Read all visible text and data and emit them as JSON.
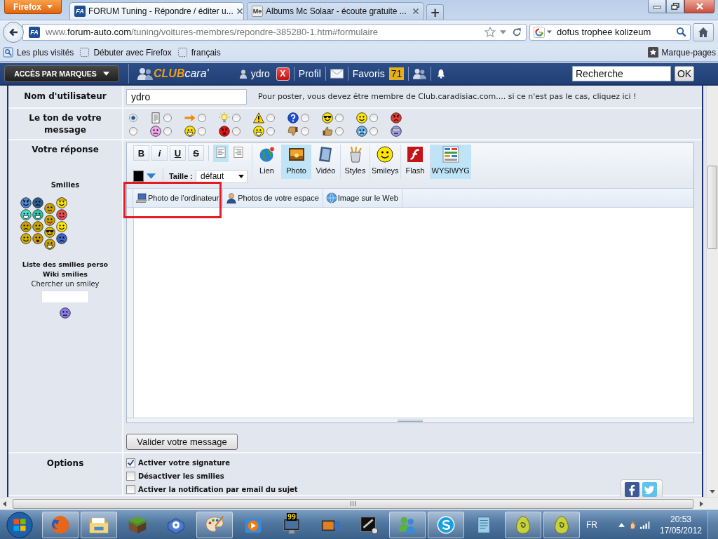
{
  "browser": {
    "menu_button": "Firefox",
    "tabs": [
      {
        "favicon": "FA",
        "title": "FORUM Tuning - Répondre / éditer u...",
        "selected": true
      },
      {
        "favicon": "Me",
        "title": "Albums Mc Solaar - écoute gratuite ...",
        "selected": false
      }
    ],
    "new_tab": "+",
    "address": {
      "favicon": "FA",
      "prefix": "www.",
      "domain": "forum-auto.com",
      "path": "/tuning/voitures-membres/repondre-385280-1.htm#formulaire"
    },
    "search": {
      "value": "dofus trophee kolizeum"
    },
    "bookmarks": [
      {
        "kind": "most-visited",
        "label": "Les plus visités"
      },
      {
        "kind": "page",
        "label": "Débuter avec Firefox"
      },
      {
        "kind": "page",
        "label": "français"
      }
    ],
    "bookmarks_menu": "Marque-pages"
  },
  "site_header": {
    "brands_button": "ACCÈS PAR MARQUES",
    "logo": {
      "club": "CLUB",
      "cara": "cara'"
    },
    "user": "ydro",
    "logout": "X",
    "profile": "Profil",
    "favorites": "Favoris",
    "favorites_count": "71",
    "search": {
      "value": "Recherche"
    },
    "search_button": "OK"
  },
  "form": {
    "username": {
      "label": "Nom d'utilisateur",
      "value": "ydro",
      "notice": "Pour poster, vous devez être membre de Club.caradisiac.com.... si ce n'est pas le cas, cliquez ici !"
    },
    "tone": {
      "label": "Le ton de votre message",
      "options": [
        {
          "kind": "document",
          "selected": true
        },
        {
          "kind": "arrow",
          "selected": false
        },
        {
          "kind": "bulb",
          "selected": false
        },
        {
          "kind": "warning",
          "selected": false
        },
        {
          "kind": "question",
          "selected": false
        },
        {
          "kind": "cool",
          "selected": false
        },
        {
          "kind": "smile",
          "selected": false
        },
        {
          "kind": "angry",
          "selected": false
        },
        {
          "kind": "sad",
          "selected": false
        },
        {
          "kind": "grin",
          "selected": false
        },
        {
          "kind": "mad",
          "selected": false
        },
        {
          "kind": "happy",
          "selected": false
        },
        {
          "kind": "thumbs-down",
          "selected": false
        },
        {
          "kind": "thumbs-up",
          "selected": false
        },
        {
          "kind": "cry",
          "selected": false
        },
        {
          "kind": "shades",
          "selected": false
        }
      ]
    },
    "reply": {
      "label": "Votre réponse",
      "smilies": {
        "title": "Smilies",
        "links": [
          "Liste des smilies perso",
          "Wiki smilies"
        ],
        "search_label": "Chercher un smiley"
      },
      "editor": {
        "format_buttons": [
          {
            "kind": "bold",
            "label": "B"
          },
          {
            "kind": "italic",
            "label": "i"
          },
          {
            "kind": "underline",
            "label": "U"
          },
          {
            "kind": "strike",
            "label": "S"
          }
        ],
        "align_buttons": [
          {
            "kind": "left",
            "active": true
          },
          {
            "kind": "right",
            "active": false
          }
        ],
        "size_label": "Taille :",
        "size_value": "défaut",
        "tools": [
          {
            "kind": "link",
            "label": "Lien",
            "active": false
          },
          {
            "kind": "photo",
            "label": "Photo",
            "active": true
          },
          {
            "kind": "video",
            "label": "Vidéo",
            "active": false
          },
          {
            "kind": "styles",
            "label": "Styles",
            "active": false
          },
          {
            "kind": "smileys",
            "label": "Smileys",
            "active": false
          },
          {
            "kind": "flash",
            "label": "Flash",
            "active": false
          },
          {
            "kind": "wysiwyg",
            "label": "WYSIWYG",
            "active": true
          }
        ],
        "insert_tabs": [
          {
            "kind": "computer",
            "label": "Photo de l'ordinateur"
          },
          {
            "kind": "space",
            "label": "Photos de votre espace"
          },
          {
            "kind": "web",
            "label": "Image sur le Web"
          }
        ]
      },
      "submit": "Valider votre message"
    },
    "options": {
      "label": "Options",
      "checkboxes": [
        {
          "label": "Activer votre signature",
          "checked": true
        },
        {
          "label": "Désactiver les smilies",
          "checked": false
        },
        {
          "label": "Activer la notification par email du sujet",
          "checked": false
        }
      ]
    }
  },
  "taskbar": {
    "apps": [
      {
        "kind": "firefox",
        "running": true
      },
      {
        "kind": "explorer",
        "running": true
      },
      {
        "kind": "minecraft",
        "running": false
      },
      {
        "kind": "gear",
        "running": false
      },
      {
        "kind": "paint",
        "running": true
      },
      {
        "kind": "media",
        "running": false
      },
      {
        "kind": "monitor",
        "running": false,
        "badge": "99"
      },
      {
        "kind": "movie",
        "running": false
      },
      {
        "kind": "game",
        "running": false
      },
      {
        "kind": "messenger",
        "running": true
      },
      {
        "kind": "skype",
        "running": true
      },
      {
        "kind": "notepad",
        "running": false
      },
      {
        "kind": "egg",
        "running": true
      },
      {
        "kind": "egg",
        "running": true
      }
    ],
    "tray": {
      "language": "FR",
      "time": "20:53",
      "date": "17/05/2012"
    }
  }
}
